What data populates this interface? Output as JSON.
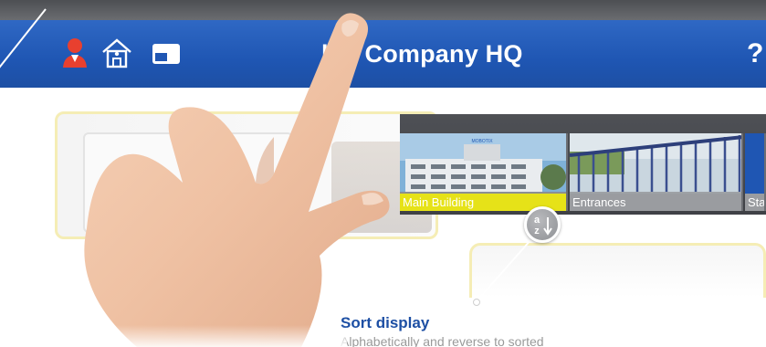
{
  "header": {
    "title": "le - Company HQ",
    "help_symbol": "?",
    "icons": [
      "user-icon",
      "building-icon",
      "window-icon"
    ]
  },
  "camera_strip": {
    "tiles": [
      {
        "label": "Main Building",
        "selected": true
      },
      {
        "label": "Entrances",
        "selected": false
      },
      {
        "label": "Sta",
        "selected": false
      }
    ],
    "sign_text": "MOBOTIX"
  },
  "sort_button": {
    "icon": "sort-alpha-icon",
    "letter_top": "a",
    "letter_bottom": "z"
  },
  "callout": {
    "title": "Sort display",
    "description": "Alphabetically and reverse to sorted"
  },
  "colors": {
    "header_blue": "#1f56b3",
    "title_blue": "#1d4fa4",
    "selected_tile": "#e6e218",
    "user_icon": "#e8402f"
  }
}
